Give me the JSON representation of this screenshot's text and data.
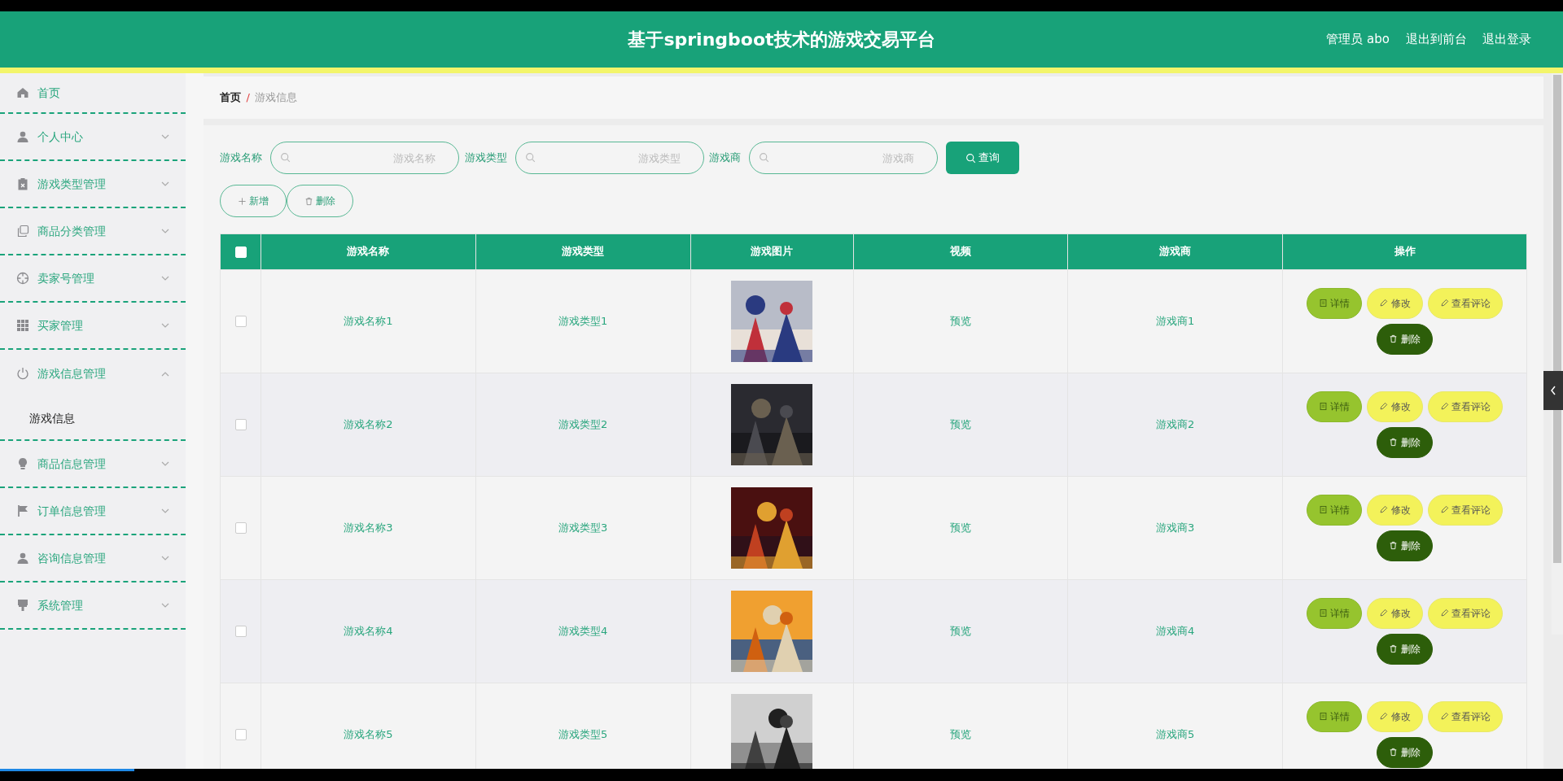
{
  "header": {
    "title": "基于springboot技术的游戏交易平台",
    "links": [
      "管理员 abo",
      "退出到前台",
      "退出登录"
    ]
  },
  "sidebar": {
    "items": [
      {
        "label": "首页",
        "kind": "link"
      },
      {
        "label": "个人中心",
        "kind": "menu",
        "expanded": false
      },
      {
        "label": "游戏类型管理",
        "kind": "menu",
        "expanded": false
      },
      {
        "label": "商品分类管理",
        "kind": "menu",
        "expanded": false
      },
      {
        "label": "卖家号管理",
        "kind": "menu",
        "expanded": false
      },
      {
        "label": "买家管理",
        "kind": "menu",
        "expanded": false
      },
      {
        "label": "游戏信息管理",
        "kind": "menu",
        "expanded": true,
        "children": [
          {
            "label": "游戏信息"
          }
        ]
      },
      {
        "label": "商品信息管理",
        "kind": "menu",
        "expanded": false
      },
      {
        "label": "订单信息管理",
        "kind": "menu",
        "expanded": false
      },
      {
        "label": "咨询信息管理",
        "kind": "menu",
        "expanded": false
      },
      {
        "label": "系统管理",
        "kind": "menu",
        "expanded": false
      }
    ]
  },
  "breadcrumb": {
    "items": [
      "首页",
      "游戏信息"
    ],
    "separator": "/"
  },
  "search": {
    "fields": [
      {
        "label": "游戏名称",
        "placeholder": "游戏名称"
      },
      {
        "label": "游戏类型",
        "placeholder": "游戏类型"
      },
      {
        "label": "游戏商",
        "placeholder": "游戏商"
      }
    ],
    "button": "查询"
  },
  "toolbar": [
    "新增",
    "删除"
  ],
  "table": {
    "columns": [
      "游戏名称",
      "游戏类型",
      "游戏图片",
      "视频",
      "游戏商",
      "操作"
    ],
    "all_checked": false,
    "rows": [
      {
        "checked": false,
        "cells": [
          "游戏名称1",
          "游戏类型1",
          "",
          "预览",
          "游戏商1"
        ],
        "actions": [
          "详情",
          "修改",
          "查看评论",
          "删除"
        ]
      },
      {
        "checked": false,
        "cells": [
          "游戏名称2",
          "游戏类型2",
          "",
          "预览",
          "游戏商2"
        ],
        "actions": [
          "详情",
          "修改",
          "查看评论",
          "删除"
        ]
      },
      {
        "checked": false,
        "cells": [
          "游戏名称3",
          "游戏类型3",
          "",
          "预览",
          "游戏商3"
        ],
        "actions": [
          "详情",
          "修改",
          "查看评论",
          "删除"
        ]
      },
      {
        "checked": false,
        "cells": [
          "游戏名称4",
          "游戏类型4",
          "",
          "预览",
          "游戏商4"
        ],
        "actions": [
          "详情",
          "修改",
          "查看评论",
          "删除"
        ]
      },
      {
        "checked": false,
        "cells": [
          "游戏名称5",
          "游戏类型5",
          "",
          "预览",
          "游戏商5"
        ],
        "actions": [
          "详情",
          "修改",
          "查看评论",
          "删除"
        ]
      }
    ]
  }
}
